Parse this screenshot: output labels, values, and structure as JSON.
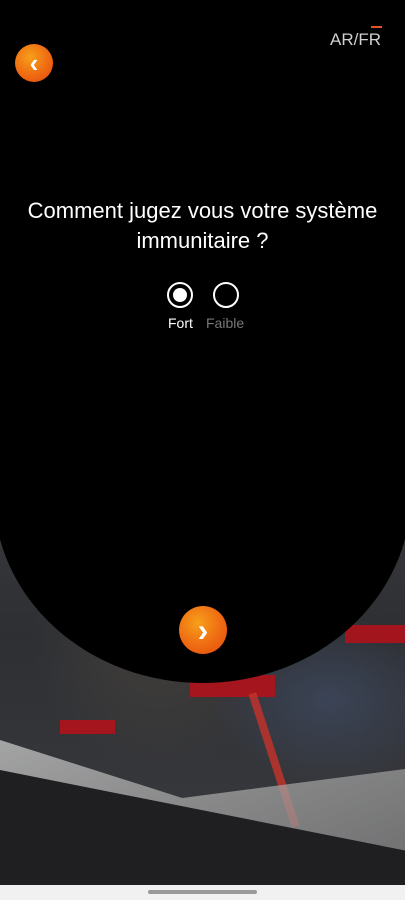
{
  "header": {
    "back_icon": "chevron-left-icon",
    "language_toggle": "AR/FR"
  },
  "question": {
    "text": "Comment jugez vous votre système immunitaire ?"
  },
  "options": [
    {
      "label": "Fort",
      "selected": true
    },
    {
      "label": "Faible",
      "selected": false
    }
  ],
  "footer": {
    "next_icon": "chevron-right-icon"
  },
  "colors": {
    "accent": "#ef6a12",
    "background": "#000000",
    "text": "#ffffff",
    "muted_text": "#777777"
  }
}
